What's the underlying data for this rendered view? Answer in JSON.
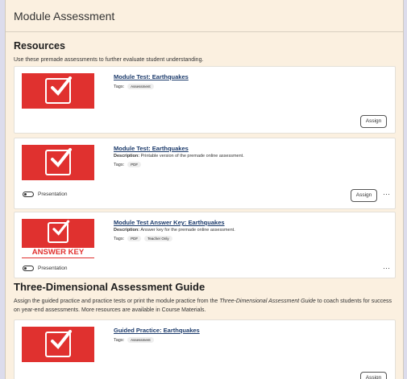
{
  "header": {
    "title": "Module Assessment"
  },
  "resources": {
    "title": "Resources",
    "description": "Use these premade assessments to further evaluate student understanding."
  },
  "cards": [
    {
      "title": "Module Test: Earthquakes",
      "tags_label": "Tags:",
      "tags": [
        "Assessment"
      ],
      "assign_label": "Assign"
    },
    {
      "title": "Module Test: Earthquakes",
      "description_label": "Description:",
      "description": "Printable version of the premade online assessment.",
      "tags_label": "Tags:",
      "tags": [
        "PDF"
      ],
      "presentation_label": "Presentation",
      "assign_label": "Assign",
      "more_label": "···"
    },
    {
      "title": "Module Test Answer Key: Earthquakes",
      "description_label": "Description:",
      "description": "Answer key for the premade online assessment.",
      "tags_label": "Tags:",
      "tags": [
        "PDF",
        "Teacher Only"
      ],
      "thumb_caption": "ANSWER KEY",
      "presentation_label": "Presentation",
      "more_label": "···"
    },
    {
      "title": "Guided Practice: Earthquakes",
      "tags_label": "Tags:",
      "tags": [
        "Assessment"
      ],
      "assign_label": "Assign"
    }
  ],
  "tdag": {
    "title": "Three-Dimensional Assessment Guide",
    "desc_part1": "Assign the guided practice and practice tests or print the module practice from the ",
    "desc_italic": "Three-Dimensional Assessment Guide",
    "desc_part2": " to coach students for success on year-end assessments. More resources are available in Course Materials."
  },
  "colors": {
    "thumb_red": "#e0312f",
    "link_blue": "#1b3a6b",
    "panel_bg": "#fbf0e0"
  }
}
